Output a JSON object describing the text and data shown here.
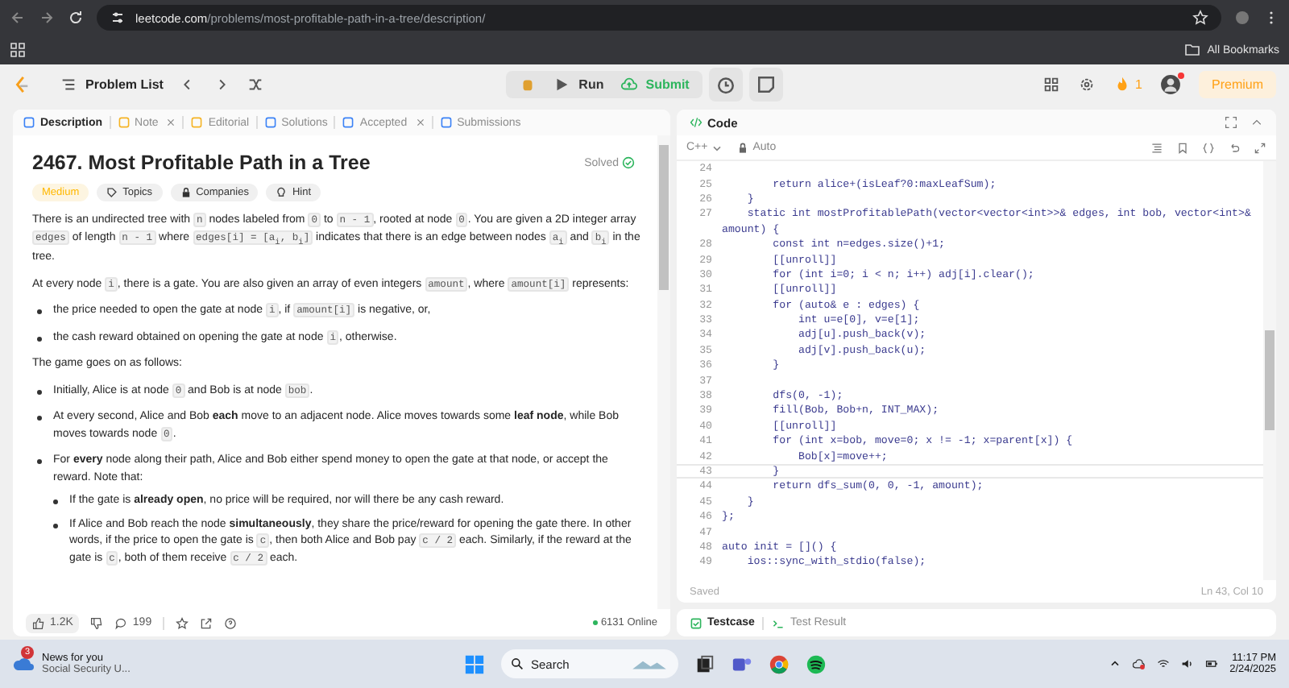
{
  "browser": {
    "url_domain": "leetcode.com",
    "url_path": "/problems/most-profitable-path-in-a-tree/description/",
    "bookmarks": "All Bookmarks"
  },
  "toolbar": {
    "problem_list": "Problem List",
    "run": "Run",
    "submit": "Submit",
    "streak": "1",
    "premium": "Premium"
  },
  "left_tabs": [
    {
      "kind": "description",
      "label": "Description",
      "selected": true,
      "closable": false
    },
    {
      "kind": "note",
      "label": "Note",
      "selected": false,
      "closable": true
    },
    {
      "kind": "editorial",
      "label": "Editorial",
      "selected": false,
      "closable": false
    },
    {
      "kind": "solutions",
      "label": "Solutions",
      "selected": false,
      "closable": false
    },
    {
      "kind": "accepted",
      "label": "Accepted",
      "selected": false,
      "closable": true
    },
    {
      "kind": "submissions",
      "label": "Submissions",
      "selected": false,
      "closable": false
    }
  ],
  "problem": {
    "title": "2467. Most Profitable Path in a Tree",
    "status": "Solved",
    "tags": [
      {
        "kind": "difficulty",
        "label": "Medium"
      },
      {
        "kind": "topics",
        "label": "Topics"
      },
      {
        "kind": "companies",
        "label": "Companies"
      },
      {
        "kind": "hint",
        "label": "Hint"
      }
    ],
    "blocks": [
      {
        "kind": "p",
        "parts": [
          {
            "kind": "text",
            "text": "There is an undirected tree with "
          },
          {
            "kind": "code",
            "text": "n"
          },
          {
            "kind": "text",
            "text": " nodes labeled from "
          },
          {
            "kind": "code",
            "text": "0"
          },
          {
            "kind": "text",
            "text": " to "
          },
          {
            "kind": "code",
            "text": "n - 1"
          },
          {
            "kind": "text",
            "text": ", rooted at node "
          },
          {
            "kind": "code",
            "text": "0"
          },
          {
            "kind": "text",
            "text": ". You are given a 2D integer array "
          },
          {
            "kind": "code",
            "text": "edges"
          },
          {
            "kind": "text",
            "text": " of length "
          },
          {
            "kind": "code",
            "text": "n - 1"
          },
          {
            "kind": "text",
            "text": " where "
          },
          {
            "kind": "code",
            "text": "edges[i] = [a$_{i}$, b$_{i}$]"
          },
          {
            "kind": "text",
            "text": " indicates that there is an edge between nodes "
          },
          {
            "kind": "code",
            "text": "a$_{i}$"
          },
          {
            "kind": "text",
            "text": " and "
          },
          {
            "kind": "code",
            "text": "b$_{i}$"
          },
          {
            "kind": "text",
            "text": " in the tree."
          }
        ]
      },
      {
        "kind": "p",
        "parts": [
          {
            "kind": "text",
            "text": "At every node "
          },
          {
            "kind": "code",
            "text": "i"
          },
          {
            "kind": "text",
            "text": ", there is a gate. You are also given an array of even integers "
          },
          {
            "kind": "code",
            "text": "amount"
          },
          {
            "kind": "text",
            "text": ", where "
          },
          {
            "kind": "code",
            "text": "amount[i]"
          },
          {
            "kind": "text",
            "text": " represents:"
          }
        ]
      },
      {
        "kind": "li",
        "parts": [
          {
            "kind": "text",
            "text": "the price needed to open the gate at node "
          },
          {
            "kind": "code",
            "text": "i"
          },
          {
            "kind": "text",
            "text": ", if "
          },
          {
            "kind": "code",
            "text": "amount[i]"
          },
          {
            "kind": "text",
            "text": " is negative, or,"
          }
        ]
      },
      {
        "kind": "li",
        "parts": [
          {
            "kind": "text",
            "text": "the cash reward obtained on opening the gate at node "
          },
          {
            "kind": "code",
            "text": "i"
          },
          {
            "kind": "text",
            "text": ", otherwise."
          }
        ]
      },
      {
        "kind": "p",
        "parts": [
          {
            "kind": "text",
            "text": "The game goes on as follows:"
          }
        ]
      },
      {
        "kind": "li",
        "parts": [
          {
            "kind": "text",
            "text": "Initially, Alice is at node "
          },
          {
            "kind": "code",
            "text": "0"
          },
          {
            "kind": "text",
            "text": " and Bob is at node "
          },
          {
            "kind": "code",
            "text": "bob"
          },
          {
            "kind": "text",
            "text": "."
          }
        ]
      },
      {
        "kind": "li",
        "parts": [
          {
            "kind": "text",
            "text": "At every second, Alice and Bob **each** move to an adjacent node. Alice moves towards some **leaf node**, while Bob moves towards node "
          },
          {
            "kind": "code",
            "text": "0"
          },
          {
            "kind": "text",
            "text": "."
          }
        ]
      },
      {
        "kind": "li",
        "parts": [
          {
            "kind": "text",
            "text": "For **every** node along their path, Alice and Bob either spend money to open the gate at that node, or accept the reward. Note that:"
          }
        ]
      },
      {
        "kind": "subli",
        "parts": [
          {
            "kind": "text",
            "text": "If the gate is **already open**, no price will be required, nor will there be any cash reward."
          }
        ]
      },
      {
        "kind": "subli",
        "parts": [
          {
            "kind": "text",
            "text": "If Alice and Bob reach the node **simultaneously**, they share the price/reward for opening the gate there. In other words, if the price to open the gate is "
          },
          {
            "kind": "code",
            "text": "c"
          },
          {
            "kind": "text",
            "text": ", then both Alice and Bob pay "
          },
          {
            "kind": "code",
            "text": "c / 2"
          },
          {
            "kind": "text",
            "text": " each. Similarly, if the reward at the gate is "
          },
          {
            "kind": "code",
            "text": "c"
          },
          {
            "kind": "text",
            "text": ", both of them receive "
          },
          {
            "kind": "code",
            "text": "c / 2"
          },
          {
            "kind": "text",
            "text": " each."
          }
        ]
      }
    ]
  },
  "footer": {
    "likes": "1.2K",
    "comments": "199",
    "online": "6131 Online"
  },
  "code": {
    "title": "Code",
    "language": "C++",
    "mode": "Auto",
    "saved": "Saved",
    "position": "Ln 43, Col 10",
    "lines": [
      {
        "number": "24",
        "current": false
      },
      {
        "number": "25",
        "text": "        return alice+(isLeaf?0:maxLeafSum);",
        "current": false
      },
      {
        "number": "26",
        "text": "    }",
        "current": false
      },
      {
        "number": "27",
        "text": "    static int mostProfitablePath(vector<vector<int>>& edges, int bob, vector<int>&",
        "current": false
      },
      {
        "text": "amount) {",
        "current": false
      },
      {
        "number": "28",
        "text": "        const int n=edges.size()+1;",
        "current": false
      },
      {
        "number": "29",
        "text": "        [[unroll]]",
        "current": false
      },
      {
        "number": "30",
        "text": "        for (int i=0; i < n; i++) adj[i].clear();",
        "current": false
      },
      {
        "number": "31",
        "text": "        [[unroll]]",
        "current": false
      },
      {
        "number": "32",
        "text": "        for (auto& e : edges) {",
        "current": false
      },
      {
        "number": "33",
        "text": "            int u=e[0], v=e[1];",
        "current": false
      },
      {
        "number": "34",
        "text": "            adj[u].push_back(v);",
        "current": false
      },
      {
        "number": "35",
        "text": "            adj[v].push_back(u);",
        "current": false
      },
      {
        "number": "36",
        "text": "        }",
        "current": false
      },
      {
        "number": "37",
        "current": false
      },
      {
        "number": "38",
        "text": "        dfs(0, -1);",
        "current": false
      },
      {
        "number": "39",
        "text": "        fill(Bob, Bob+n, INT_MAX);",
        "current": false
      },
      {
        "number": "40",
        "text": "        [[unroll]]",
        "current": false
      },
      {
        "number": "41",
        "text": "        for (int x=bob, move=0; x != -1; x=parent[x]) {",
        "current": false
      },
      {
        "number": "42",
        "text": "            Bob[x]=move++;",
        "current": false
      },
      {
        "number": "43",
        "text": "        }",
        "current": true
      },
      {
        "number": "44",
        "text": "        return dfs_sum(0, 0, -1, amount);",
        "current": false
      },
      {
        "number": "45",
        "text": "    }",
        "current": false
      },
      {
        "number": "46",
        "text": "};",
        "current": false
      },
      {
        "number": "47",
        "current": false
      },
      {
        "number": "48",
        "text": "auto init = []() {",
        "current": false
      },
      {
        "number": "49",
        "text": "    ios::sync_with_stdio(false);",
        "current": false
      }
    ]
  },
  "bottom_tabs": [
    {
      "kind": "testcase",
      "label": "Testcase",
      "selected": true
    },
    {
      "kind": "result",
      "label": "Test Result",
      "selected": false
    }
  ],
  "taskbar": {
    "news_badge": "3",
    "news_title": "News for you",
    "news_subtitle": "Social Security U...",
    "search": "Search",
    "time": "11:17 PM",
    "date": "2/24/2025"
  }
}
